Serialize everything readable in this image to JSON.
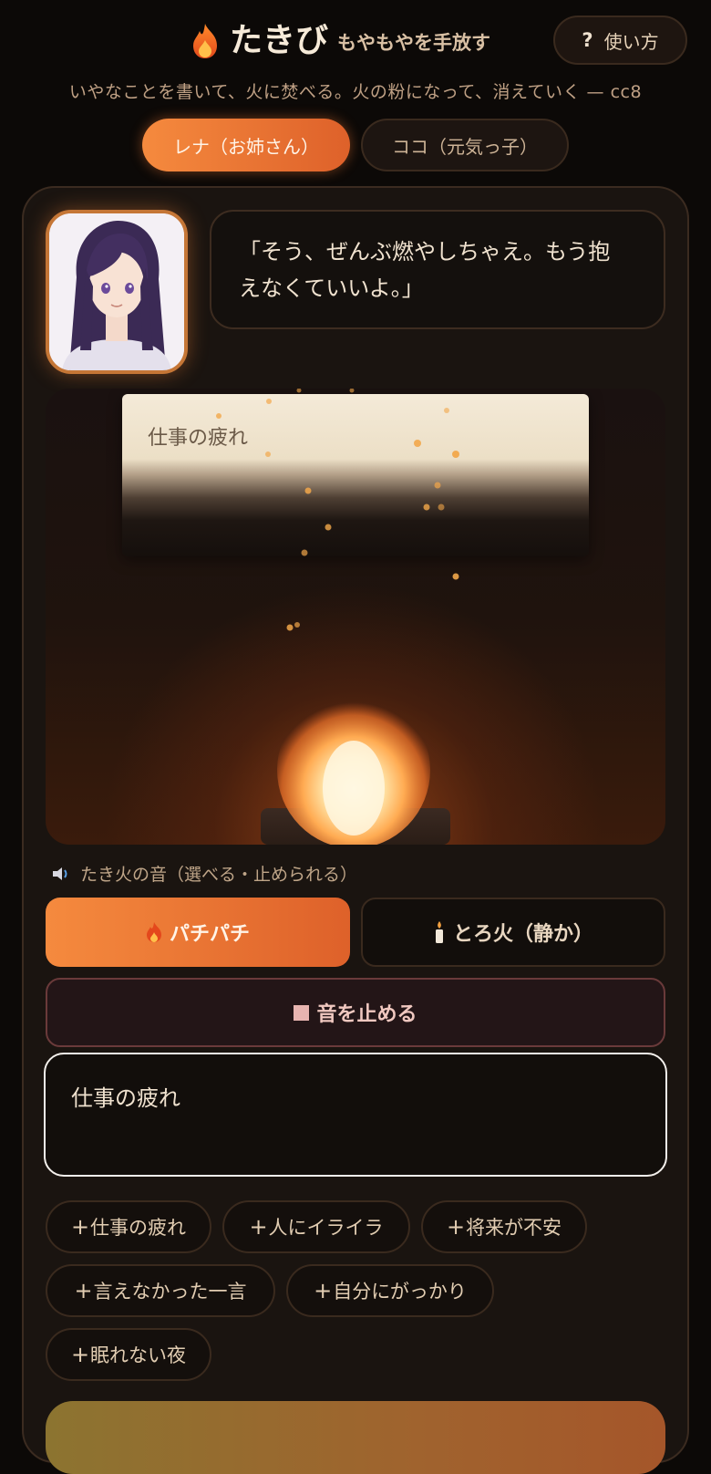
{
  "header": {
    "title": "たきび",
    "tagline": "もやもやを手放す",
    "help_label": "使い方",
    "help_glyph": "?",
    "subtitle": "いやなことを書いて、火に焚べる。火の粉になって、消えていく — cc8"
  },
  "characters": [
    {
      "label": "レナ（お姉さん）",
      "selected": true
    },
    {
      "label": "ココ（元気っ子）",
      "selected": false
    }
  ],
  "speech": {
    "text": "「そう、ぜんぶ燃やしちゃえ。もう抱えなくていいよ。」"
  },
  "stage": {
    "paper_text": "仕事の疲れ"
  },
  "sound": {
    "label": "たき火の音（選べる・止められる）",
    "options": [
      {
        "label": "パチパチ",
        "icon": "fire-icon",
        "selected": true
      },
      {
        "label": "とろ火（静か）",
        "icon": "candle-icon",
        "selected": false
      }
    ],
    "stop_label": "音を止める"
  },
  "input": {
    "value": "仕事の疲れ"
  },
  "suggestions": [
    "仕事の疲れ",
    "人にイライラ",
    "将来が不安",
    "言えなかった一言",
    "自分にがっかり",
    "眠れない夜"
  ],
  "suggestion_prefix": "+",
  "colors": {
    "accent": "#f58a3e",
    "accent_dark": "#de612a",
    "background": "#0c0907",
    "panel": "#1a1410",
    "stop_border": "#6a3a3a"
  }
}
